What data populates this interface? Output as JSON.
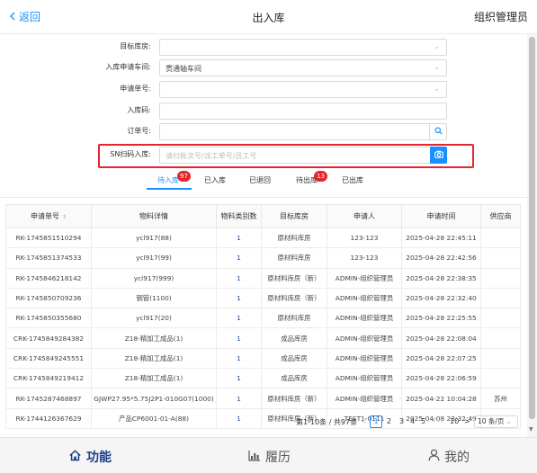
{
  "header": {
    "back_label": "返回",
    "title": "出入库",
    "user": "组织管理员"
  },
  "form": {
    "target_warehouse_label": "目标库房:",
    "in_workshop_label": "入库申请车间:",
    "in_workshop_value": "贯通轴车间",
    "request_no_label": "申请单号:",
    "in_code_label": "入库码:",
    "order_no_label": "订单号:",
    "sn_label": "SN扫码入库:",
    "sn_placeholder": "请扫批次号/派工单号/员工号"
  },
  "tabs": [
    {
      "label": "待入库",
      "badge": "97"
    },
    {
      "label": "已入库",
      "badge": ""
    },
    {
      "label": "已退回",
      "badge": ""
    },
    {
      "label": "待出库",
      "badge": "13"
    },
    {
      "label": "已出库",
      "badge": ""
    }
  ],
  "table": {
    "headers": [
      "申请单号",
      "物料详情",
      "物料类别数",
      "目标库房",
      "申请人",
      "申请时间",
      "供应商"
    ],
    "rows": [
      [
        "RK-1745851510294",
        "ycl917(88)",
        "1",
        "原材料库房",
        "123-123",
        "2025-04-28 22:45:11",
        ""
      ],
      [
        "RK-1745851374533",
        "ycl917(99)",
        "1",
        "原材料库房",
        "123-123",
        "2025-04-28 22:42:56",
        ""
      ],
      [
        "RK-1745846218142",
        "ycl917(999)",
        "1",
        "原材料库房（新）",
        "ADMIN-组织管理员",
        "2025-04-28 22:38:35",
        ""
      ],
      [
        "RK-1745850709236",
        "钢管(1100)",
        "1",
        "原材料库房（新）",
        "ADMIN-组织管理员",
        "2025-04-28 22:32:40",
        ""
      ],
      [
        "RK-1745850355680",
        "ycl917(20)",
        "1",
        "原材料库房",
        "ADMIN-组织管理员",
        "2025-04-28 22:25:55",
        ""
      ],
      [
        "CRK-1745849284382",
        "Z18-精加工成品(1)",
        "1",
        "成品库房",
        "ADMIN-组织管理员",
        "2025-04-28 22:08:04",
        ""
      ],
      [
        "CRK-1745849245551",
        "Z18-精加工成品(1)",
        "1",
        "成品库房",
        "ADMIN-组织管理员",
        "2025-04-28 22:07:25",
        ""
      ],
      [
        "CRK-1745849219412",
        "Z18-精加工成品(1)",
        "1",
        "成品库房",
        "ADMIN-组织管理员",
        "2025-04-28 22:06:59",
        ""
      ],
      [
        "RK-1745287468897",
        "GJWP27.95*5.75J2P1-010G07(1000)",
        "1",
        "原材料库房（新）",
        "ADMIN-组织管理员",
        "2025-04-22 10:04:28",
        "苏州"
      ],
      [
        "RK-1744126367629",
        "产品CP6001-01-A(88)",
        "1",
        "原材料库房（新）",
        "TEST1-0111",
        "2025-04-08 23:32:49",
        ""
      ]
    ]
  },
  "pagination": {
    "summary": "第1-10条 / 共97条",
    "prev": "<",
    "pages": [
      "1",
      "2",
      "3",
      "4",
      "5"
    ],
    "ellipsis": "•••",
    "last": "10",
    "next": ">",
    "page_size": "10 条/页"
  },
  "bottom_nav": [
    {
      "label": "功能",
      "icon": "home-icon",
      "active": true
    },
    {
      "label": "履历",
      "icon": "chart-icon",
      "active": false
    },
    {
      "label": "我的",
      "icon": "user-icon",
      "active": false
    }
  ],
  "colors": {
    "accent": "#1890ff",
    "highlight": "#e5262f",
    "nav_active": "#1a3e8c"
  }
}
